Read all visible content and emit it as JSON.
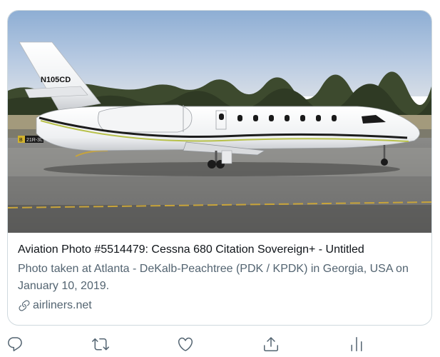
{
  "card": {
    "image_alt": "Cessna 680 Citation Sovereign+ N105CD on taxiway",
    "registration": "N105CD",
    "taxiway_sign": "21R-3L",
    "taxiway_sign_prefix": "B",
    "title": "Aviation Photo #5514479: Cessna 680 Citation Sovereign+ - Untitled",
    "description": "Photo taken at Atlanta - DeKalb-Peachtree (PDK / KPDK) in Georgia, USA on January 10, 2019.",
    "domain": "airliners.net"
  },
  "actions": {
    "reply_icon": "reply-icon",
    "retweet_icon": "retweet-icon",
    "like_icon": "heart-icon",
    "share_icon": "share-icon",
    "analytics_icon": "analytics-icon"
  },
  "colors": {
    "text_primary": "#0f1419",
    "text_secondary": "#536471",
    "border": "#cfd9de",
    "icon": "#536471"
  }
}
